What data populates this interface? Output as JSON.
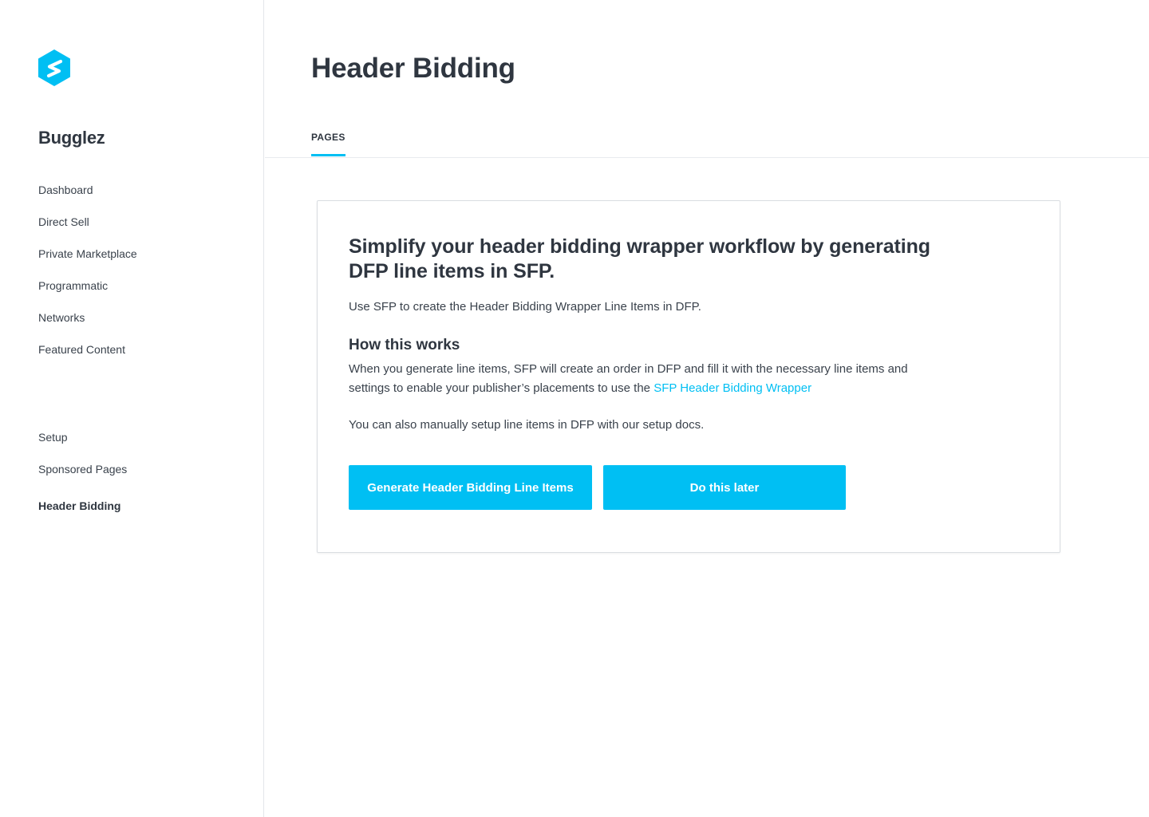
{
  "app": {
    "brand": "Bugglez",
    "logo_icon": "sfp-logo-icon",
    "accent_color": "#00bff3"
  },
  "sidebar": {
    "primary_items": [
      {
        "label": "Dashboard"
      },
      {
        "label": "Direct Sell"
      },
      {
        "label": "Private Marketplace"
      },
      {
        "label": "Programmatic"
      },
      {
        "label": "Networks"
      },
      {
        "label": "Featured Content"
      }
    ],
    "secondary_items": [
      {
        "label": "Setup"
      },
      {
        "label": "Sponsored Pages"
      },
      {
        "label": "Header Bidding",
        "active": true
      }
    ]
  },
  "header": {
    "title": "Header Bidding"
  },
  "tabs": [
    {
      "label": "PAGES",
      "active": true
    }
  ],
  "card": {
    "heading": "Simplify your header bidding wrapper workflow by generating DFP line items in SFP.",
    "subheading": "Use SFP to create the Header Bidding Wrapper Line Items in DFP.",
    "how_title": "How this works",
    "how_text": "When you generate line items, SFP will create an order in DFP and fill it with the necessary line items and settings to enable your publisher’s placements to use the",
    "how_link": "SFP Header Bidding Wrapper",
    "manual_text": "You can also manually setup line items in DFP with our setup docs.",
    "primary_button": "Generate Header Bidding Line Items",
    "secondary_button": "Do this later"
  }
}
